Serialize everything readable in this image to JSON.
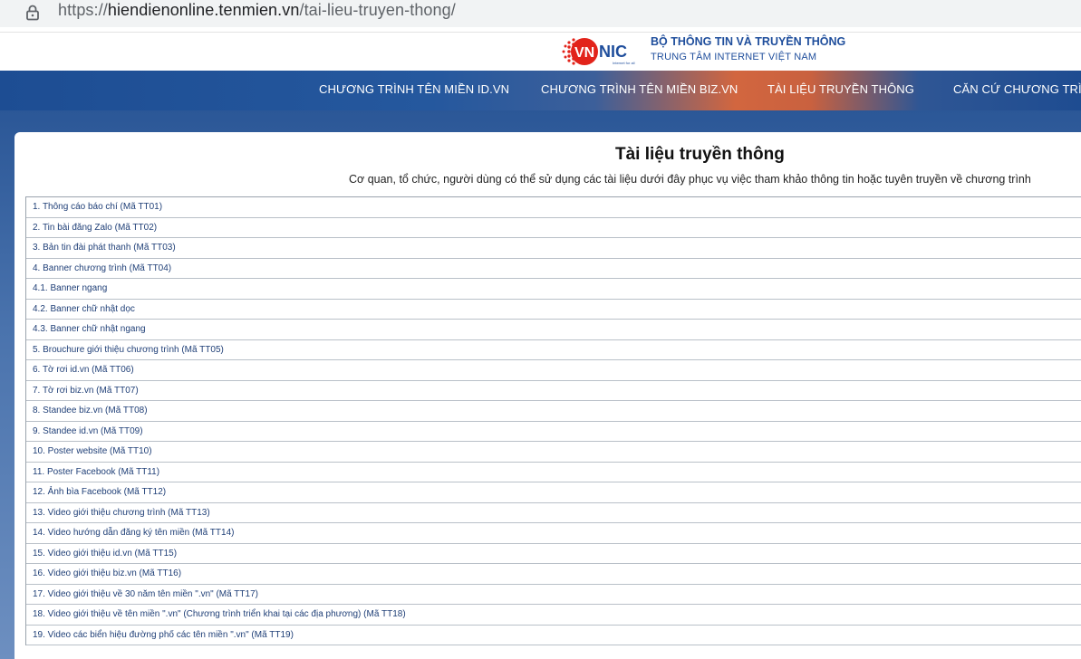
{
  "browser": {
    "url_scheme": "https://",
    "url_host": "hiendienonline.tenmien.vn",
    "url_path": "/tai-lieu-truyen-thong/"
  },
  "header": {
    "logo_text": "VNNIC",
    "logo_tagline": "Internet for all",
    "ministry": "BỘ THÔNG TIN VÀ TRUYỀN THÔNG",
    "center_name": "TRUNG TÂM INTERNET VIỆT NAM"
  },
  "nav": {
    "items": [
      {
        "label": "CHƯƠNG TRÌNH TÊN MIỀN ID.VN"
      },
      {
        "label": "CHƯƠNG TRÌNH TÊN MIỀN BIZ.VN"
      },
      {
        "label": "TÀI LIỆU TRUYỀN THÔNG"
      },
      {
        "label": "CĂN CỨ CHƯƠNG TRÌNH"
      }
    ]
  },
  "main": {
    "title": "Tài liệu truyền thông",
    "subtitle": "Cơ quan, tổ chức, người dùng có thể sử dụng các tài liệu dưới đây phục vụ việc tham khảo thông tin hoặc tuyên truyền về chương trình",
    "documents": [
      "1. Thông cáo báo chí (Mã TT01)",
      "2. Tin bài đăng Zalo (Mã TT02)",
      "3. Bản tin đài phát thanh (Mã TT03)",
      "4. Banner chương trình (Mã TT04)",
      "4.1. Banner ngang",
      "4.2. Banner chữ nhật dọc",
      "4.3. Banner chữ nhật ngang",
      "5. Brouchure giới thiệu chương trình (Mã TT05)",
      "6. Tờ rơi id.vn (Mã TT06)",
      "7. Tờ rơi biz.vn (Mã TT07)",
      "8. Standee biz.vn (Mã TT08)",
      "9. Standee id.vn (Mã TT09)",
      "10. Poster website (Mã TT10)",
      "11. Poster Facebook (Mã TT11)",
      "12. Ảnh bìa Facebook (Mã TT12)",
      "13. Video giới thiệu chương trình (Mã TT13)",
      "14. Video hướng dẫn đăng ký tên miền (Mã TT14)",
      "15. Video giới thiệu id.vn (Mã TT15)",
      "16. Video giới thiệu biz.vn (Mã TT16)",
      "17. Video giới thiệu về 30 năm tên miền \".vn\" (Mã TT17)",
      "18. Video giới thiệu về tên miền \".vn\" (Chương trình triển khai tại các địa phương) (Mã TT18)",
      "19. Video các biển hiệu đường phố các tên miền \".vn\" (Mã TT19)"
    ]
  }
}
